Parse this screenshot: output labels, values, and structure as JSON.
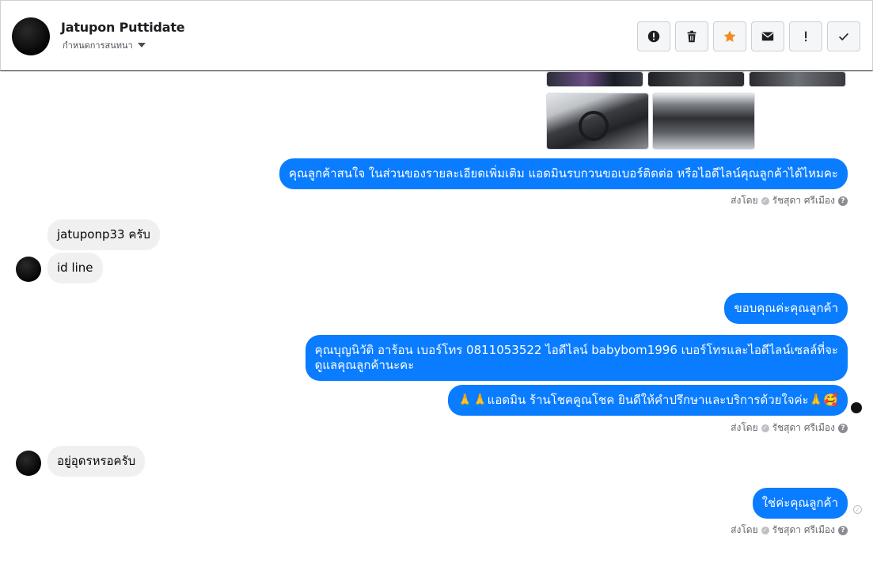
{
  "header": {
    "contact_name": "Jatupon Puttidate",
    "subtitle": "กำหนดการสนทนา",
    "actions": [
      {
        "name": "report-button",
        "icon": "alert-circle-icon"
      },
      {
        "name": "delete-button",
        "icon": "trash-icon"
      },
      {
        "name": "star-button",
        "icon": "star-icon"
      },
      {
        "name": "mail-button",
        "icon": "mail-icon"
      },
      {
        "name": "mark-important-button",
        "icon": "exclamation-icon"
      },
      {
        "name": "mark-done-button",
        "icon": "check-icon"
      }
    ],
    "star_color": "#f28b1f"
  },
  "messages": {
    "out1": "คุณลูกค้าสนใจ ในส่วนของรายละเอียดเพิ่มเติม แอดมินรบกวนขอเบอร์ติดต่อ หรือไอดีไลน์คุณลูกค้าได้ไหมคะ",
    "meta1_prefix": "ส่งโดย",
    "meta1_sender": "รัชสุดา ศรีเมือง",
    "in1": "jatuponp33 ครับ",
    "in2": "id line",
    "out2": "ขอบคุณค่ะคุณลูกค้า",
    "out3_line1": "คุณบุญนิวัติ  อาร้อน        เบอร์โทร 0811053522  ไอดีไลน์ babybom1996   เบอร์โทรและไอดีไลน์เซลล์ที่จะ",
    "out3_line2": "ดูแลคุณลูกค้านะคะ",
    "out4": "🙏🙏แอดมิน ร้านโชคคูณโชค ยินดีให้คำปรึกษาและบริการด้วยใจค่ะ🙏🥰",
    "meta2_prefix": "ส่งโดย",
    "meta2_sender": "รัชสุดา ศรีเมือง",
    "in3": "อยู่อุดรหรอครับ",
    "out5": "ใช่ค่ะคุณลูกค้า",
    "meta3_prefix": "ส่งโดย",
    "meta3_sender": "รัชสุดา ศรีเมือง"
  },
  "colors": {
    "outgoing_bubble": "#0a7cff",
    "incoming_bubble": "#f0f0f0"
  }
}
